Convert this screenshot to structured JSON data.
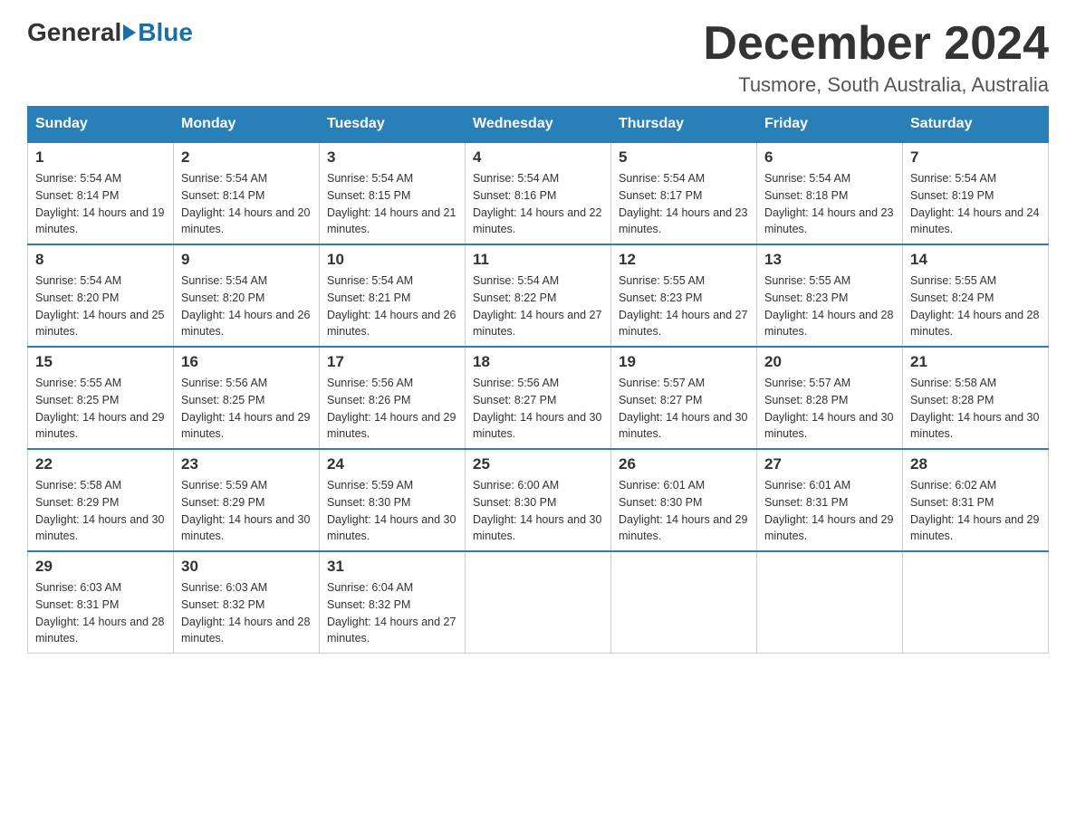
{
  "logo": {
    "general": "General",
    "blue": "Blue"
  },
  "title": "December 2024",
  "location": "Tusmore, South Australia, Australia",
  "weekdays": [
    "Sunday",
    "Monday",
    "Tuesday",
    "Wednesday",
    "Thursday",
    "Friday",
    "Saturday"
  ],
  "weeks": [
    [
      {
        "day": "1",
        "sunrise": "5:54 AM",
        "sunset": "8:14 PM",
        "daylight": "14 hours and 19 minutes."
      },
      {
        "day": "2",
        "sunrise": "5:54 AM",
        "sunset": "8:14 PM",
        "daylight": "14 hours and 20 minutes."
      },
      {
        "day": "3",
        "sunrise": "5:54 AM",
        "sunset": "8:15 PM",
        "daylight": "14 hours and 21 minutes."
      },
      {
        "day": "4",
        "sunrise": "5:54 AM",
        "sunset": "8:16 PM",
        "daylight": "14 hours and 22 minutes."
      },
      {
        "day": "5",
        "sunrise": "5:54 AM",
        "sunset": "8:17 PM",
        "daylight": "14 hours and 23 minutes."
      },
      {
        "day": "6",
        "sunrise": "5:54 AM",
        "sunset": "8:18 PM",
        "daylight": "14 hours and 23 minutes."
      },
      {
        "day": "7",
        "sunrise": "5:54 AM",
        "sunset": "8:19 PM",
        "daylight": "14 hours and 24 minutes."
      }
    ],
    [
      {
        "day": "8",
        "sunrise": "5:54 AM",
        "sunset": "8:20 PM",
        "daylight": "14 hours and 25 minutes."
      },
      {
        "day": "9",
        "sunrise": "5:54 AM",
        "sunset": "8:20 PM",
        "daylight": "14 hours and 26 minutes."
      },
      {
        "day": "10",
        "sunrise": "5:54 AM",
        "sunset": "8:21 PM",
        "daylight": "14 hours and 26 minutes."
      },
      {
        "day": "11",
        "sunrise": "5:54 AM",
        "sunset": "8:22 PM",
        "daylight": "14 hours and 27 minutes."
      },
      {
        "day": "12",
        "sunrise": "5:55 AM",
        "sunset": "8:23 PM",
        "daylight": "14 hours and 27 minutes."
      },
      {
        "day": "13",
        "sunrise": "5:55 AM",
        "sunset": "8:23 PM",
        "daylight": "14 hours and 28 minutes."
      },
      {
        "day": "14",
        "sunrise": "5:55 AM",
        "sunset": "8:24 PM",
        "daylight": "14 hours and 28 minutes."
      }
    ],
    [
      {
        "day": "15",
        "sunrise": "5:55 AM",
        "sunset": "8:25 PM",
        "daylight": "14 hours and 29 minutes."
      },
      {
        "day": "16",
        "sunrise": "5:56 AM",
        "sunset": "8:25 PM",
        "daylight": "14 hours and 29 minutes."
      },
      {
        "day": "17",
        "sunrise": "5:56 AM",
        "sunset": "8:26 PM",
        "daylight": "14 hours and 29 minutes."
      },
      {
        "day": "18",
        "sunrise": "5:56 AM",
        "sunset": "8:27 PM",
        "daylight": "14 hours and 30 minutes."
      },
      {
        "day": "19",
        "sunrise": "5:57 AM",
        "sunset": "8:27 PM",
        "daylight": "14 hours and 30 minutes."
      },
      {
        "day": "20",
        "sunrise": "5:57 AM",
        "sunset": "8:28 PM",
        "daylight": "14 hours and 30 minutes."
      },
      {
        "day": "21",
        "sunrise": "5:58 AM",
        "sunset": "8:28 PM",
        "daylight": "14 hours and 30 minutes."
      }
    ],
    [
      {
        "day": "22",
        "sunrise": "5:58 AM",
        "sunset": "8:29 PM",
        "daylight": "14 hours and 30 minutes."
      },
      {
        "day": "23",
        "sunrise": "5:59 AM",
        "sunset": "8:29 PM",
        "daylight": "14 hours and 30 minutes."
      },
      {
        "day": "24",
        "sunrise": "5:59 AM",
        "sunset": "8:30 PM",
        "daylight": "14 hours and 30 minutes."
      },
      {
        "day": "25",
        "sunrise": "6:00 AM",
        "sunset": "8:30 PM",
        "daylight": "14 hours and 30 minutes."
      },
      {
        "day": "26",
        "sunrise": "6:01 AM",
        "sunset": "8:30 PM",
        "daylight": "14 hours and 29 minutes."
      },
      {
        "day": "27",
        "sunrise": "6:01 AM",
        "sunset": "8:31 PM",
        "daylight": "14 hours and 29 minutes."
      },
      {
        "day": "28",
        "sunrise": "6:02 AM",
        "sunset": "8:31 PM",
        "daylight": "14 hours and 29 minutes."
      }
    ],
    [
      {
        "day": "29",
        "sunrise": "6:03 AM",
        "sunset": "8:31 PM",
        "daylight": "14 hours and 28 minutes."
      },
      {
        "day": "30",
        "sunrise": "6:03 AM",
        "sunset": "8:32 PM",
        "daylight": "14 hours and 28 minutes."
      },
      {
        "day": "31",
        "sunrise": "6:04 AM",
        "sunset": "8:32 PM",
        "daylight": "14 hours and 27 minutes."
      },
      null,
      null,
      null,
      null
    ]
  ]
}
